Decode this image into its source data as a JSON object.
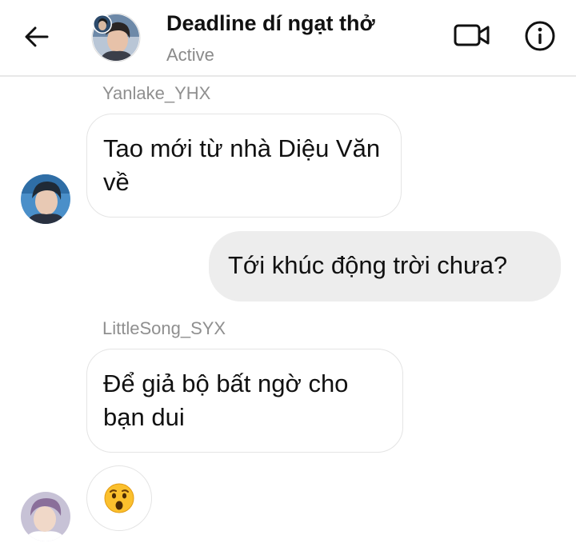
{
  "header": {
    "back_icon": "arrow-left-icon",
    "title": "Deadline dí ngạt thở",
    "status": "Active",
    "video_icon": "video-camera-icon",
    "info_icon": "info-icon"
  },
  "messages": [
    {
      "sender": "Yanlake_YHX",
      "direction": "incoming",
      "text": "Tao mới từ nhà Diệu Văn về"
    },
    {
      "direction": "outgoing",
      "text": "Tới khúc động trời chưa?"
    },
    {
      "sender": "LittleSong_SYX",
      "direction": "incoming",
      "text": "Để giả bộ bất ngờ cho bạn dui"
    },
    {
      "direction": "incoming",
      "emoji": "hushed-face",
      "text": "😲"
    }
  ],
  "colors": {
    "header_border": "#e8e8e8",
    "incoming_border": "#e4e4e4",
    "outgoing_bg": "#ededed",
    "sender_name": "#8f8f8f",
    "status_text": "#8a8a8a",
    "emoji_face": "#fbc02d"
  }
}
